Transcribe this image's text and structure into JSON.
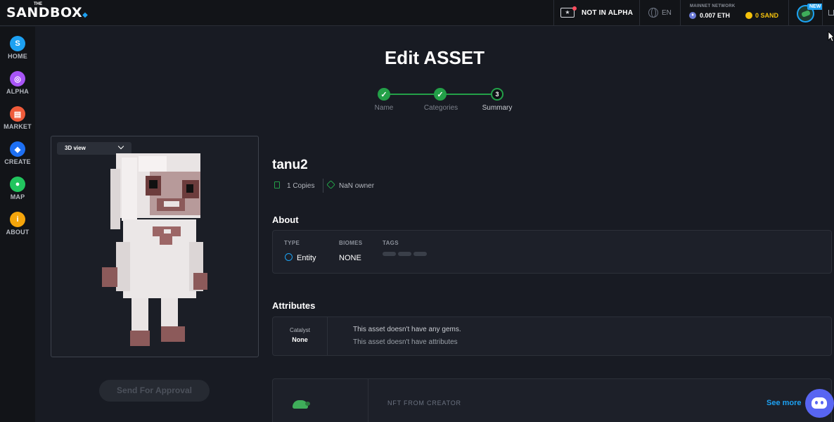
{
  "header": {
    "logo_text": "SANDBOX",
    "logo_prefix": "THE",
    "alpha_badge": "NOT IN ALPHA",
    "language": "EN",
    "network_label": "MAINNET NETWORK",
    "eth_balance": "0.007 ETH",
    "sand_balance": "0 SAND",
    "new_badge": "NEW"
  },
  "sidebar": {
    "items": [
      {
        "label": "HOME",
        "glyph": "S",
        "color": "#1da1f2"
      },
      {
        "label": "ALPHA",
        "glyph": "◎",
        "color": "#a855f7"
      },
      {
        "label": "MARKET",
        "glyph": "▤",
        "color": "#ef5b3a"
      },
      {
        "label": "CREATE",
        "glyph": "◆",
        "color": "#1d6ff2"
      },
      {
        "label": "MAP",
        "glyph": "●",
        "color": "#22c55e"
      },
      {
        "label": "ABOUT",
        "glyph": "i",
        "color": "#f5a50b"
      }
    ]
  },
  "page": {
    "title": "Edit ASSET"
  },
  "stepper": {
    "steps": [
      {
        "label": "Name",
        "status": "done",
        "marker": "✓"
      },
      {
        "label": "Categories",
        "status": "done",
        "marker": "✓"
      },
      {
        "label": "Summary",
        "status": "current",
        "marker": "3"
      }
    ]
  },
  "viewer": {
    "view_mode": "3D view"
  },
  "actions": {
    "send_label": "Send For Approval"
  },
  "asset": {
    "name": "tanu2",
    "copies": "1 Copies",
    "owners": "NaN owner"
  },
  "about": {
    "title": "About",
    "type_head": "TYPE",
    "type_value": "Entity",
    "biomes_head": "BIOMES",
    "biomes_value": "NONE",
    "tags_head": "TAGS"
  },
  "attributes": {
    "title": "Attributes",
    "catalyst_label": "Catalyst",
    "catalyst_value": "None",
    "gems_text": "This asset doesn't have any gems.",
    "attributes_text": "This asset doesn't have attributes"
  },
  "creator": {
    "label": "NFT FROM CREATOR",
    "see_more": "See more"
  },
  "colors": {
    "accent_green": "#23a048",
    "accent_blue": "#1da1f2",
    "sand_yellow": "#f5c20b"
  }
}
